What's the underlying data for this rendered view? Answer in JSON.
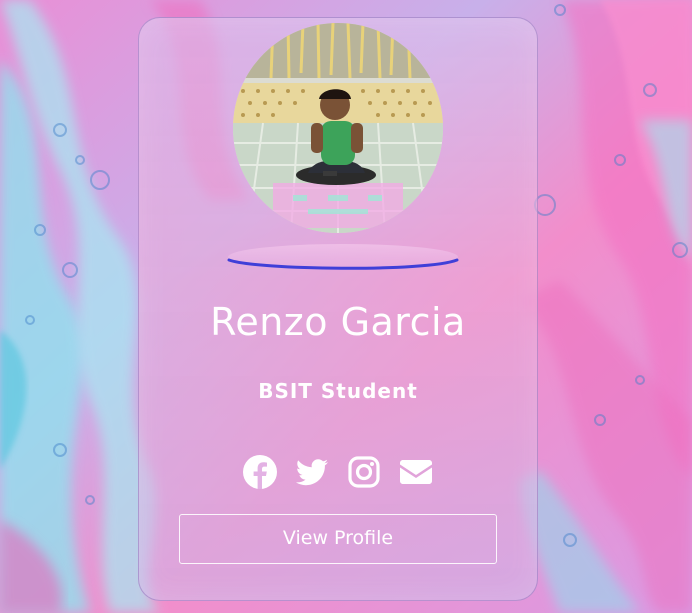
{
  "profile": {
    "name": "Renzo Garcia",
    "role": "BSIT Student",
    "button_label": "View Profile"
  },
  "social_links": [
    {
      "icon": "facebook-icon"
    },
    {
      "icon": "twitter-icon"
    },
    {
      "icon": "instagram-icon"
    },
    {
      "icon": "envelope-icon"
    }
  ],
  "colors": {
    "background_pink": "#f07cc8",
    "background_cyan": "#8fe0ec",
    "background_lavender": "#c7a8e6",
    "ring_accent": "#3f3fd8",
    "text": "#ffffff"
  }
}
